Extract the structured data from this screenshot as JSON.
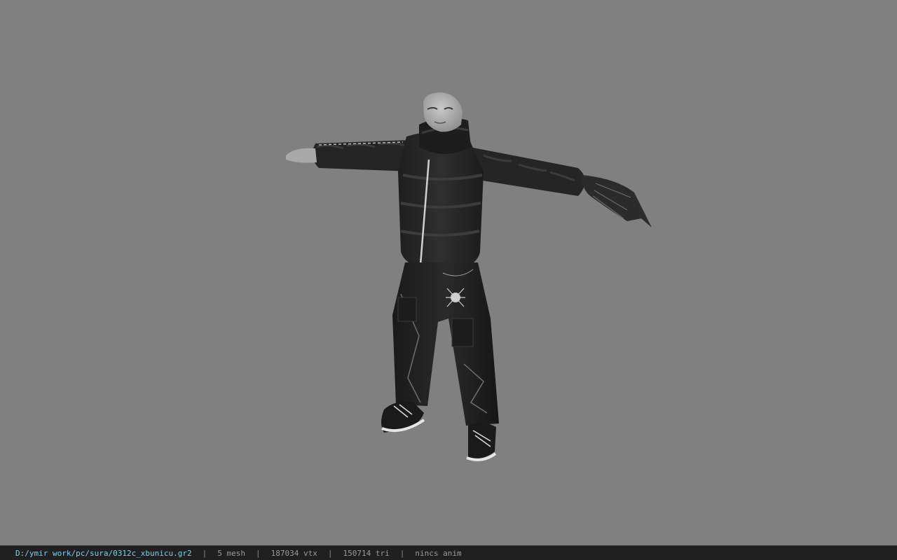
{
  "viewport": {
    "background_color": "#808080",
    "model_name": "character-model"
  },
  "status_bar": {
    "file_path": "D:/ymir work/pc/sura/0312c_xbunicu.gr2",
    "separator": "|",
    "mesh_count": "5 mesh",
    "vertex_count": "187034 vtx",
    "triangle_count": "150714 tri",
    "anim_status": "nincs anim",
    "path_color": "#7fd0e8",
    "text_color": "#9a9a9a",
    "bar_color": "#202020"
  }
}
